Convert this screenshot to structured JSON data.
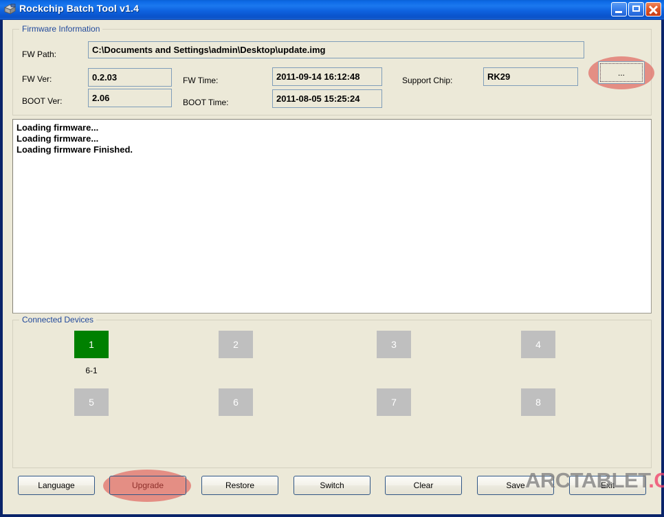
{
  "window": {
    "title": "Rockchip Batch Tool v1.4",
    "icon": "app-tool-icon",
    "controls": {
      "minimize": "minimize-icon",
      "maximize": "maximize-icon",
      "close": "close-icon"
    }
  },
  "firmware": {
    "group_title": "Firmware Information",
    "fw_path_label": "FW Path:",
    "fw_path_value": "C:\\Documents and Settings\\admin\\Desktop\\update.img",
    "browse_label": "...",
    "fw_ver_label": "FW Ver:",
    "fw_ver_value": "0.2.03",
    "fw_time_label": "FW Time:",
    "fw_time_value": "2011-09-14 16:12:48",
    "support_chip_label": "Support Chip:",
    "support_chip_value": "RK29",
    "boot_ver_label": "BOOT Ver:",
    "boot_ver_value": "2.06",
    "boot_time_label": "BOOT Time:",
    "boot_time_value": "2011-08-05 15:25:24"
  },
  "log": {
    "lines": [
      "Loading firmware...",
      "Loading firmware...",
      "Loading firmware Finished."
    ]
  },
  "devices": {
    "group_title": "Connected Devices",
    "slots": [
      {
        "number": "1",
        "state": "active",
        "caption": "6-1"
      },
      {
        "number": "2",
        "state": "empty",
        "caption": ""
      },
      {
        "number": "3",
        "state": "empty",
        "caption": ""
      },
      {
        "number": "4",
        "state": "empty",
        "caption": ""
      },
      {
        "number": "5",
        "state": "empty",
        "caption": ""
      },
      {
        "number": "6",
        "state": "empty",
        "caption": ""
      },
      {
        "number": "7",
        "state": "empty",
        "caption": ""
      },
      {
        "number": "8",
        "state": "empty",
        "caption": ""
      }
    ],
    "active_color": "#008000",
    "empty_color": "#bfbfbf"
  },
  "buttons": [
    {
      "label": "Language"
    },
    {
      "label": "Upgrade"
    },
    {
      "label": "Restore"
    },
    {
      "label": "Switch"
    },
    {
      "label": "Clear"
    },
    {
      "label": "Save"
    },
    {
      "label": "Exit"
    }
  ],
  "annotations": {
    "highlight_color": "#e06b64",
    "browse_highlight": "browse-button-highlight",
    "upgrade_highlight": "upgrade-button-highlight"
  },
  "watermark": {
    "part1": "ARCTABLET",
    "part2": ".COM",
    "color1": "#808080",
    "color2": "#f0426a"
  }
}
